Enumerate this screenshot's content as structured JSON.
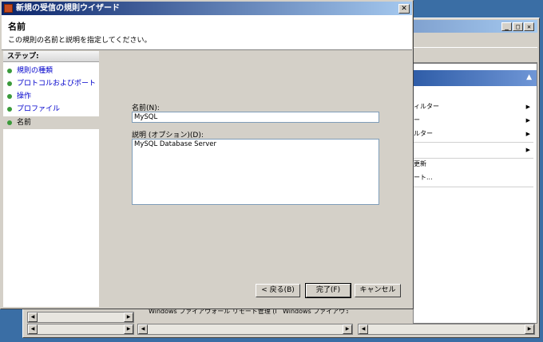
{
  "dialog": {
    "title": "新規の受信の規則ウイザード",
    "header_title": "名前",
    "header_subtitle": "この規則の名前と説明を指定してください。",
    "steps_header": "ステップ:",
    "steps": [
      {
        "label": "規則の種類"
      },
      {
        "label": "プロトコルおよびポート"
      },
      {
        "label": "操作"
      },
      {
        "label": "プロファイル"
      },
      {
        "label": "名前"
      }
    ],
    "name_label": "名前(N):",
    "name_value": "MySQL",
    "desc_label": "説明 (オプション)(D):",
    "desc_value": "MySQL Database Server",
    "buttons": {
      "back": "< 戻る(B)",
      "finish": "完了(F)",
      "cancel": "キャンセル"
    },
    "close_glyph": "✕"
  },
  "background_window": {
    "window_buttons": [
      "_",
      "□",
      "✕"
    ],
    "actions": [
      {
        "label": "ィルター",
        "arrow": "▶"
      },
      {
        "label": "ー",
        "arrow": "▶"
      },
      {
        "label": "ルター",
        "arrow": "▶"
      },
      {
        "label": "",
        "arrow": "▶"
      },
      {
        "label": "更新",
        "arrow": ""
      },
      {
        "label": "ート...",
        "arrow": ""
      }
    ],
    "collapse_glyph": "▲",
    "grid_cells": [
      "Windows ファイアウォール リモート管理 (RPC)",
      "Windows ファイアウォー"
    ]
  }
}
